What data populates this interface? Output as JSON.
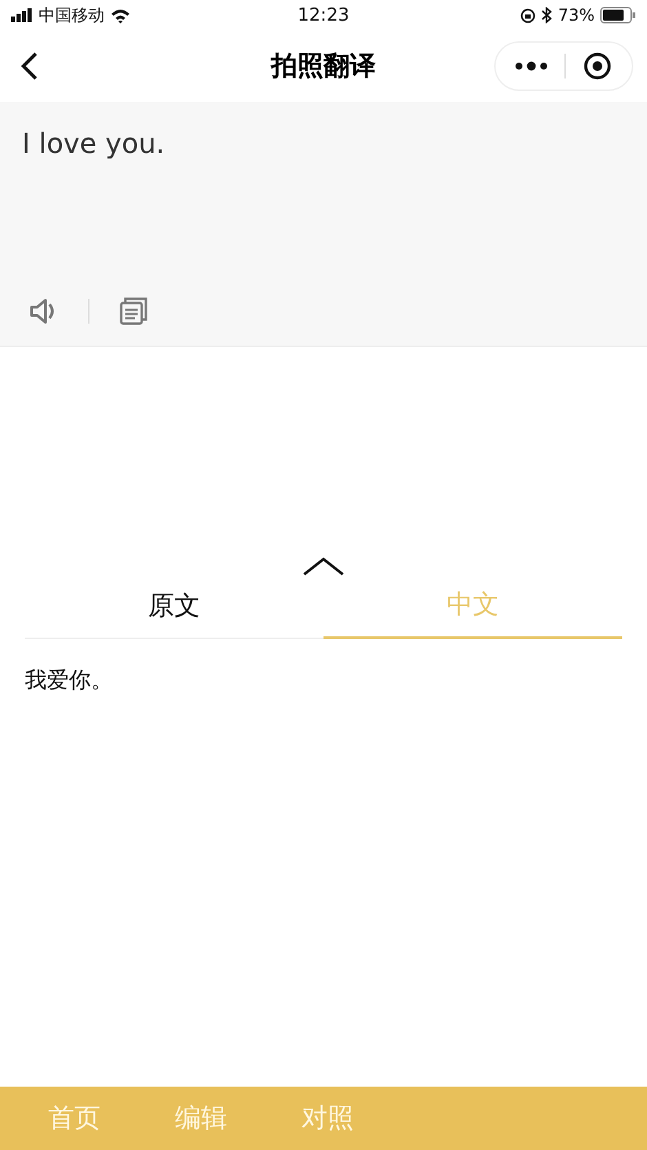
{
  "status_bar": {
    "carrier": "中国移动",
    "time": "12:23",
    "battery": "73%"
  },
  "nav_bar": {
    "title": "拍照翻译"
  },
  "source": {
    "text": "I love you."
  },
  "tabs": [
    {
      "label": "原文",
      "selected": false
    },
    {
      "label": "中文",
      "selected": true
    }
  ],
  "result": {
    "text": "我爱你。"
  },
  "bottom_bar": {
    "items": [
      "首页",
      "编辑",
      "对照"
    ]
  }
}
